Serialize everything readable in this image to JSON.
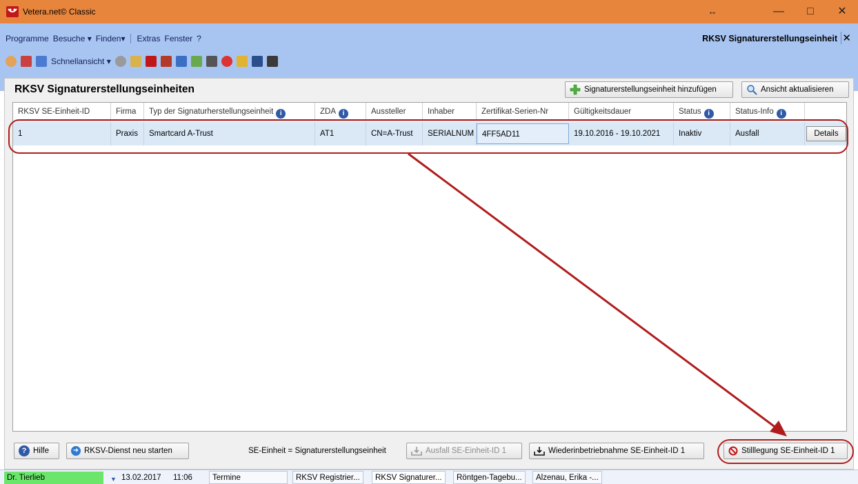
{
  "window": {
    "title": "Vetera.net© Classic",
    "controls": {
      "restore": "↔",
      "minimize": "—",
      "maximize": "□",
      "close": "✕"
    }
  },
  "menu": {
    "items": [
      "Programme",
      "Besuche ▾",
      "Finden▾",
      "Extras",
      "Fenster",
      "?"
    ],
    "active_window_title": "RKSV Signaturerstellungseinheit",
    "close": "✕"
  },
  "toolbar": {
    "schnellansicht_label": "Schnellansicht ▾",
    "icons": [
      "people-icon",
      "printer-icon",
      "list-icon",
      "paw-icon",
      "book-icon",
      "vetera-icon",
      "pet-icon",
      "card-icon",
      "medicine-icon",
      "tools-icon",
      "lifebuoy-icon",
      "lab-icon",
      "document-icon",
      "calculator-icon"
    ]
  },
  "panel": {
    "title": "RKSV Signaturerstellungseinheiten",
    "add_button": "Signaturerstellungseinheit hinzufügen",
    "refresh_button": "Ansicht aktualisieren"
  },
  "grid": {
    "columns": [
      "RKSV SE-Einheit-ID",
      "Firma",
      "Typ der Signaturherstellungseinheit",
      "ZDA",
      "Aussteller",
      "Inhaber",
      "Zertifikat-Serien-Nr",
      "Gültigkeitsdauer",
      "Status",
      "Status-Info"
    ],
    "rows": [
      {
        "id": "1",
        "firma": "Praxis",
        "typ": "Smartcard A-Trust",
        "zda": "AT1",
        "aussteller": "CN=A-Trust",
        "inhaber": "SERIALNUM",
        "serien_nr": "4FF5AD11",
        "gueltigkeit": "19.10.2016 - 19.10.2021",
        "status": "Inaktiv",
        "status_info": "Ausfall",
        "details": "Details"
      }
    ]
  },
  "footer": {
    "help": "Hilfe",
    "restart": "RKSV-Dienst neu starten",
    "legend": "SE-Einheit = Signaturerstellungseinheit",
    "ausfall": "Ausfall SE-Einheit-ID 1",
    "wiederinbetrieb": "Wiederinbetriebnahme SE-Einheit-ID 1",
    "stilllegung": "Stilllegung SE-Einheit-ID 1"
  },
  "statusbar": {
    "user": "Dr. Tierlieb",
    "date": "13.02.2017",
    "time": "11:06",
    "termine": "Termine",
    "tabs": [
      "RKSV Registrier...",
      "RKSV Signaturer...",
      "Röntgen-Tagebu...",
      "Alzenau, Erika -..."
    ]
  },
  "colors": {
    "titlebar": "#e8853c",
    "menubar": "#a8c4f0",
    "annotation": "#b01c1c",
    "user_badge": "#6be66b"
  }
}
